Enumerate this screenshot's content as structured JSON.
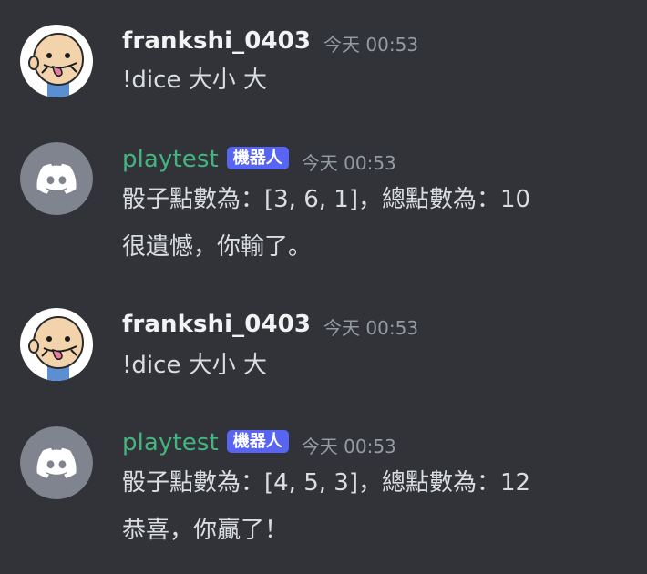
{
  "messages": [
    {
      "author": "frankshi_0403",
      "timestamp": "今天 00:53",
      "lines": [
        "!dice 大小 大"
      ]
    },
    {
      "author": "playtest",
      "bot_tag": "機器人",
      "timestamp": "今天 00:53",
      "lines": [
        "骰子點數為：[3, 6, 1]，總點數為：10",
        "很遺憾，你輸了。"
      ]
    },
    {
      "author": "frankshi_0403",
      "timestamp": "今天 00:53",
      "lines": [
        "!dice 大小 大"
      ]
    },
    {
      "author": "playtest",
      "bot_tag": "機器人",
      "timestamp": "今天 00:53",
      "lines": [
        "骰子點數為：[4, 5, 3]，總點數為：12",
        "恭喜，你贏了！"
      ]
    }
  ],
  "colors": {
    "background": "#313338",
    "bot_name": "#43b581",
    "bot_tag": "#5865f2",
    "discord_avatar": "#80848e"
  },
  "icons": {
    "user_avatar": "cartoon-face-avatar",
    "bot_avatar": "discord-logo-icon"
  }
}
